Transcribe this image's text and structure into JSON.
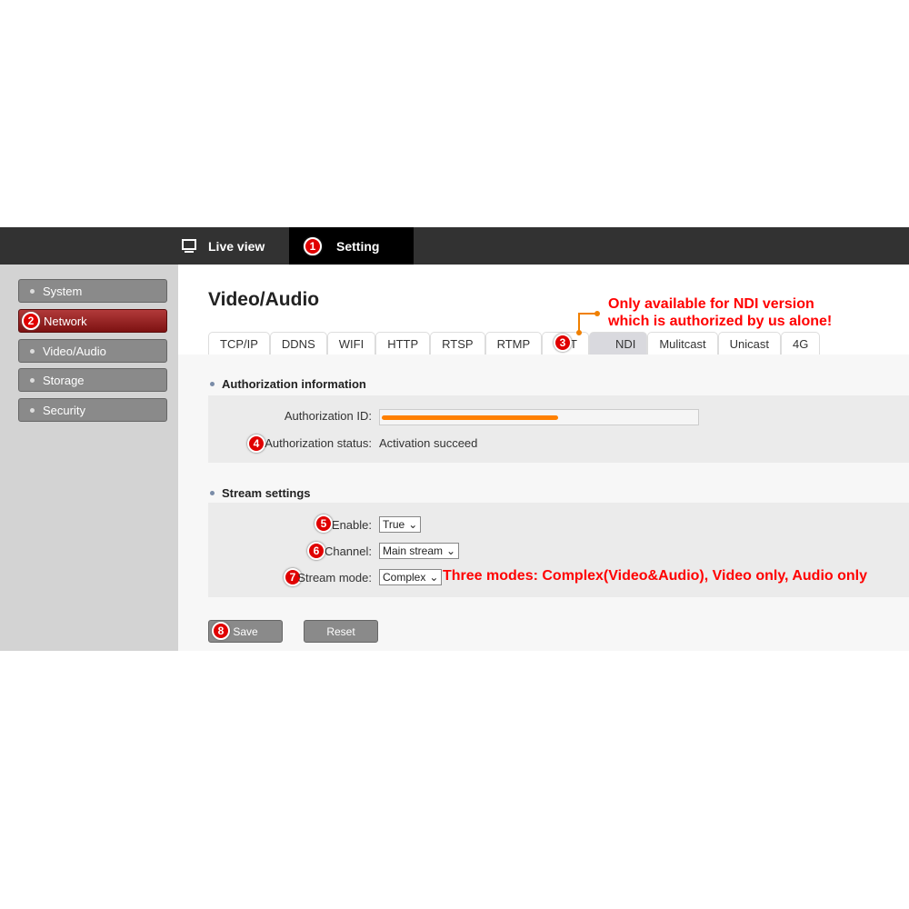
{
  "topbar": {
    "live_view": "Live view",
    "setting": "Setting"
  },
  "sidebar": {
    "items": [
      {
        "label": "System"
      },
      {
        "label": "Network"
      },
      {
        "label": "Video/Audio"
      },
      {
        "label": "Storage"
      },
      {
        "label": "Security"
      }
    ]
  },
  "page_title": "Video/Audio",
  "tabs": [
    "TCP/IP",
    "DDNS",
    "WIFI",
    "HTTP",
    "RTSP",
    "RTMP",
    "SRT",
    "NDI",
    "Mulitcast",
    "Unicast",
    "4G"
  ],
  "auth": {
    "heading": "Authorization information",
    "id_label": "Authorization ID:",
    "id_value": "",
    "status_label": "Authorization status:",
    "status_value": "Activation succeed"
  },
  "stream": {
    "heading": "Stream settings",
    "enable_label": "Enable:",
    "enable_value": "True",
    "channel_label": "Channel:",
    "channel_value": "Main stream",
    "mode_label": "Stream mode:",
    "mode_value": "Complex"
  },
  "buttons": {
    "save": "Save",
    "reset": "Reset"
  },
  "annotations": {
    "badges": [
      "1",
      "2",
      "3",
      "4",
      "5",
      "6",
      "7",
      "8"
    ],
    "ndi_note_1": "Only available for NDI version",
    "ndi_note_2": "which is authorized by us alone!",
    "mode_note": "Three modes: Complex(Video&Audio), Video only, Audio only"
  },
  "colors": {
    "accent_red": "#e00000",
    "redaction": "#ff8000"
  }
}
